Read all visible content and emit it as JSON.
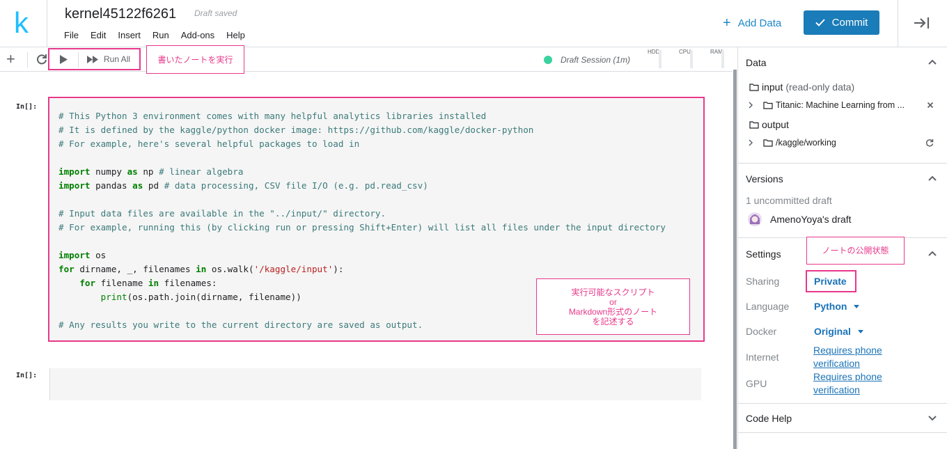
{
  "header": {
    "logo_letter": "k",
    "title": "kernel45122f6261",
    "status": "Draft saved",
    "menu": [
      "File",
      "Edit",
      "Insert",
      "Run",
      "Add-ons",
      "Help"
    ],
    "add_data_label": "Add Data",
    "commit_label": "Commit"
  },
  "toolbar": {
    "run_all_label": "Run All",
    "session_label": "Draft Session (1m)",
    "meters": [
      "HDD",
      "CPU",
      "RAM"
    ]
  },
  "annotations": {
    "run": "書いたノートを実行",
    "cell_line1": "実行可能なスクリプト",
    "cell_line2": "or",
    "cell_line3": "Markdown形式のノート",
    "cell_line4": "を記述する",
    "sharing": "ノートの公開状態"
  },
  "cells": [
    {
      "prompt": "In[]:",
      "lines": [
        [
          [
            "c",
            "# This Python 3 environment comes with many helpful analytics libraries installed"
          ]
        ],
        [
          [
            "c",
            "# It is defined by the kaggle/python docker image: https://github.com/kaggle/docker-python"
          ]
        ],
        [
          [
            "c",
            "# For example, here's several helpful packages to load in"
          ]
        ],
        [],
        [
          [
            "k",
            "import"
          ],
          [
            "t",
            " numpy "
          ],
          [
            "k",
            "as"
          ],
          [
            "t",
            " np "
          ],
          [
            "c",
            "# linear algebra"
          ]
        ],
        [
          [
            "k",
            "import"
          ],
          [
            "t",
            " pandas "
          ],
          [
            "k",
            "as"
          ],
          [
            "t",
            " pd "
          ],
          [
            "c",
            "# data processing, CSV file I/O (e.g. pd.read_csv)"
          ]
        ],
        [],
        [
          [
            "c",
            "# Input data files are available in the \"../input/\" directory."
          ]
        ],
        [
          [
            "c",
            "# For example, running this (by clicking run or pressing Shift+Enter) will list all files under the input directory"
          ]
        ],
        [],
        [
          [
            "k",
            "import"
          ],
          [
            "t",
            " os"
          ]
        ],
        [
          [
            "k",
            "for"
          ],
          [
            "t",
            " dirname, _, filenames "
          ],
          [
            "k",
            "in"
          ],
          [
            "t",
            " os.walk("
          ],
          [
            "s",
            "'/kaggle/input'"
          ],
          [
            "t",
            "):"
          ]
        ],
        [
          [
            "t",
            "    "
          ],
          [
            "k",
            "for"
          ],
          [
            "t",
            " filename "
          ],
          [
            "k",
            "in"
          ],
          [
            "t",
            " filenames:"
          ]
        ],
        [
          [
            "t",
            "        "
          ],
          [
            "b",
            "print"
          ],
          [
            "t",
            "(os.path.join(dirname, filename))"
          ]
        ],
        [],
        [
          [
            "c",
            "# Any results you write to the current directory are saved as output."
          ]
        ]
      ]
    },
    {
      "prompt": "In[]:",
      "lines": []
    }
  ],
  "sidebar": {
    "data": {
      "title": "Data",
      "input_label": "input",
      "input_note": "(read-only data)",
      "dataset": "Titanic: Machine Learning from ...",
      "output_label": "output",
      "working_dir": "/kaggle/working"
    },
    "versions": {
      "title": "Versions",
      "uncommitted": "1 uncommitted draft",
      "draft_owner": "AmenoYoya's draft"
    },
    "settings": {
      "title": "Settings",
      "sharing_label": "Sharing",
      "sharing_value": "Private",
      "language_label": "Language",
      "language_value": "Python",
      "docker_label": "Docker",
      "docker_value": "Original",
      "internet_label": "Internet",
      "internet_value": "Requires phone verification",
      "gpu_label": "GPU",
      "gpu_value": "Requires phone verification"
    },
    "code_help": {
      "title": "Code Help"
    }
  },
  "colors": {
    "brand": "#20beff",
    "commit": "#1a7cb8",
    "annotation": "#e8388a",
    "session": "#3ad29f"
  }
}
